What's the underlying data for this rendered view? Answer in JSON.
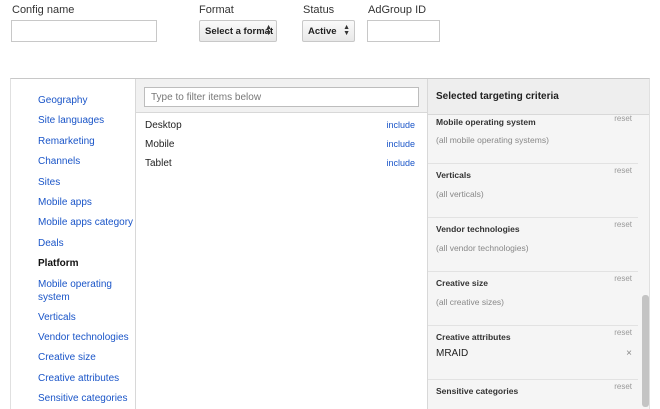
{
  "filters": {
    "config_name_label": "Config name",
    "format_label": "Format",
    "format_value": "Select a format",
    "status_label": "Status",
    "status_value": "Active",
    "adgroup_label": "AdGroup ID"
  },
  "nav": {
    "items": [
      {
        "label": "Geography"
      },
      {
        "label": "Site languages"
      },
      {
        "label": "Remarketing"
      },
      {
        "label": "Channels"
      },
      {
        "label": "Sites"
      },
      {
        "label": "Mobile apps"
      },
      {
        "label": "Mobile apps category"
      },
      {
        "label": "Deals"
      },
      {
        "label": "Platform",
        "active": true
      },
      {
        "label": "Mobile operating system"
      },
      {
        "label": "Verticals"
      },
      {
        "label": "Vendor technologies"
      },
      {
        "label": "Creative size"
      },
      {
        "label": "Creative attributes"
      },
      {
        "label": "Sensitive categories"
      }
    ]
  },
  "middle": {
    "filter_placeholder": "Type to filter items below",
    "rows": [
      {
        "label": "Desktop",
        "action": "include"
      },
      {
        "label": "Mobile",
        "action": "include"
      },
      {
        "label": "Tablet",
        "action": "include"
      }
    ]
  },
  "right": {
    "title": "Selected targeting criteria",
    "reset_label": "reset",
    "sections": [
      {
        "title": "Mobile operating system",
        "sub": "(all mobile operating systems)"
      },
      {
        "title": "Verticals",
        "sub": "(all verticals)"
      },
      {
        "title": "Vendor technologies",
        "sub": "(all vendor technologies)"
      },
      {
        "title": "Creative size",
        "sub": "(all creative sizes)"
      },
      {
        "title": "Creative attributes",
        "value": "MRAID",
        "remove": "×"
      },
      {
        "title": "Sensitive categories"
      }
    ]
  }
}
